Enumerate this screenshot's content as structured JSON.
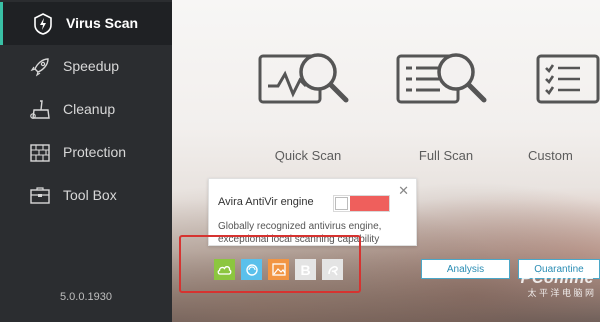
{
  "sidebar": {
    "items": [
      {
        "label": "Virus Scan",
        "icon": "shield-bolt-icon",
        "active": true
      },
      {
        "label": "Speedup",
        "icon": "rocket-icon",
        "active": false
      },
      {
        "label": "Cleanup",
        "icon": "broom-icon",
        "active": false
      },
      {
        "label": "Protection",
        "icon": "firewall-icon",
        "active": false
      },
      {
        "label": "Tool Box",
        "icon": "toolbox-icon",
        "active": false
      }
    ],
    "version": "5.0.0.1930"
  },
  "scan_options": [
    {
      "label": "Quick Scan",
      "icon": "quick-scan-icon"
    },
    {
      "label": "Full Scan",
      "icon": "full-scan-icon"
    },
    {
      "label": "Custom",
      "icon": "custom-scan-icon"
    }
  ],
  "engine_popup": {
    "title": "Avira AntiVir engine",
    "description": "Globally recognized antivirus engine, exceptional local scanning capability",
    "toggle_on": false
  },
  "engines": [
    {
      "name": "cloud-engine-icon",
      "color": "#8cc63f",
      "enabled": true
    },
    {
      "name": "sync-engine-icon",
      "color": "#5bc0eb",
      "enabled": true
    },
    {
      "name": "image-engine-icon",
      "color": "#f29543",
      "enabled": true
    },
    {
      "name": "b-engine-icon",
      "color": "#e6e6e6",
      "enabled": false
    },
    {
      "name": "a-engine-icon",
      "color": "#e6e6e6",
      "enabled": false
    }
  ],
  "buttons": {
    "analysis": "Analysis",
    "quarantine": "Quarantine"
  },
  "watermark": {
    "brand": "PConline",
    "sub": "太 平 洋 电 脑 网"
  },
  "colors": {
    "accent": "#39c0a5",
    "toggle_off": "#ef5f5c",
    "highlight": "#d63330",
    "button": "#2a8db4"
  }
}
